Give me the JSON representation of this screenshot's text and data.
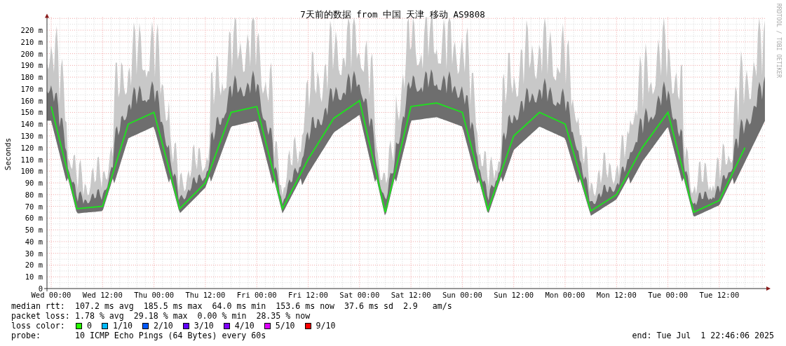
{
  "title": "7天前的数据 from 中国 天津 移动 AS9808",
  "credit": "RRDTOOL / TOBI OETIKER",
  "chart_data": {
    "type": "line",
    "ylabel": "Seconds",
    "ylim": [
      0,
      231
    ],
    "grid": true,
    "categories": [
      "Wed 00:00",
      null,
      "Wed 12:00",
      null,
      "Thu 00:00",
      null,
      "Thu 12:00",
      null,
      "Fri 00:00",
      null,
      "Fri 12:00",
      null,
      "Sat 00:00",
      null,
      "Sat 12:00",
      null,
      "Sun 00:00",
      null,
      "Sun 12:00",
      null,
      "Mon 00:00",
      null,
      "Mon 12:00",
      null,
      "Tue 00:00",
      null,
      "Tue 12:00",
      null
    ],
    "yticks": [
      {
        "value": 0,
        "label": "0"
      },
      {
        "value": 10,
        "label": "10 m"
      },
      {
        "value": 20,
        "label": "20 m"
      },
      {
        "value": 30,
        "label": "30 m"
      },
      {
        "value": 40,
        "label": "40 m"
      },
      {
        "value": 50,
        "label": "50 m"
      },
      {
        "value": 60,
        "label": "60 m"
      },
      {
        "value": 70,
        "label": "70 m"
      },
      {
        "value": 80,
        "label": "80 m"
      },
      {
        "value": 90,
        "label": "90 m"
      },
      {
        "value": 100,
        "label": "100 m"
      },
      {
        "value": 110,
        "label": "110 m"
      },
      {
        "value": 120,
        "label": "120 m"
      },
      {
        "value": 130,
        "label": "130 m"
      },
      {
        "value": 140,
        "label": "140 m"
      },
      {
        "value": 150,
        "label": "150 m"
      },
      {
        "value": 160,
        "label": "160 m"
      },
      {
        "value": 170,
        "label": "170 m"
      },
      {
        "value": 180,
        "label": "180 m"
      },
      {
        "value": 190,
        "label": "190 m"
      },
      {
        "value": 200,
        "label": "200 m"
      },
      {
        "value": 210,
        "label": "210 m"
      },
      {
        "value": 220,
        "label": "220 m"
      }
    ],
    "series": [
      {
        "color": "#22dd22",
        "values": [
          155,
          68,
          70,
          140,
          150,
          68,
          90,
          150,
          155,
          68,
          110,
          145,
          160,
          65,
          155,
          158,
          150,
          67,
          130,
          150,
          140,
          66,
          80,
          120,
          150,
          65,
          75,
          120
        ]
      }
    ]
  },
  "legend": {
    "median_rtt": {
      "label": "median rtt:",
      "stats": [
        "107.2 ms avg",
        "185.5 ms max",
        "64.0 ms min",
        "153.6 ms now",
        "37.6 ms sd",
        "2.9   am/s"
      ]
    },
    "packet_loss": {
      "label": "packet loss:",
      "stats": [
        "1.78 % avg",
        "29.18 % max",
        "0.00 % min",
        "28.35 % now"
      ]
    },
    "loss_color": {
      "label": "loss color:",
      "items": [
        {
          "label": "0",
          "color": "#26ff00"
        },
        {
          "label": "1/10",
          "color": "#00b8ff"
        },
        {
          "label": "2/10",
          "color": "#0059ff"
        },
        {
          "label": "3/10",
          "color": "#5e00ff"
        },
        {
          "label": "4/10",
          "color": "#7e00ff"
        },
        {
          "label": "5/10",
          "color": "#dd00ff"
        },
        {
          "label": "9/10",
          "color": "#ff0000"
        }
      ]
    },
    "probe": {
      "label": "probe:",
      "value": "10 ICMP Echo Pings (64 Bytes) every 60s"
    },
    "end": "end: Tue Jul  1 22:46:06 2025"
  }
}
